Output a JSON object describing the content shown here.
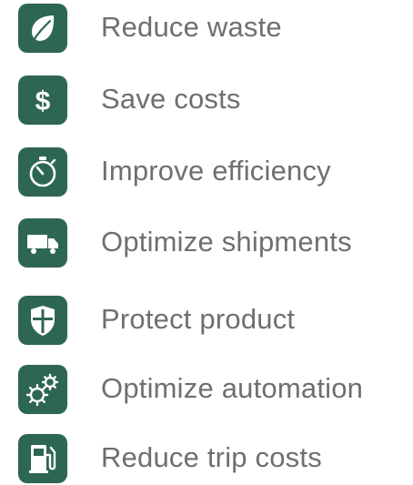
{
  "items": [
    {
      "label": "Reduce waste",
      "icon": "leaf-icon"
    },
    {
      "label": "Save costs",
      "icon": "dollar-icon"
    },
    {
      "label": "Improve efficiency",
      "icon": "stopwatch-icon"
    },
    {
      "label": "Optimize shipments",
      "icon": "truck-icon"
    },
    {
      "label": "Protect product",
      "icon": "shield-icon"
    },
    {
      "label": "Optimize automation",
      "icon": "gears-icon"
    },
    {
      "label": "Reduce trip costs",
      "icon": "fuel-pump-icon"
    }
  ],
  "colors": {
    "icon_background": "#2e6654",
    "icon_foreground": "#ffffff",
    "text": "#6f6f6f"
  }
}
